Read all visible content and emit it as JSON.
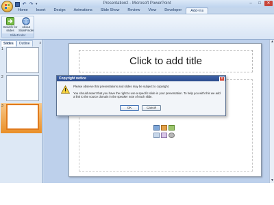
{
  "window": {
    "title": "Presentation2 - Microsoft PowerPoint",
    "controls": {
      "minimize": "–",
      "maximize": "□",
      "close": "✕"
    }
  },
  "qat": {
    "undo": "↶",
    "redo": "↷",
    "dropdown": "▾"
  },
  "ribbon": {
    "tabs": [
      "Home",
      "Insert",
      "Design",
      "Animations",
      "Slide Show",
      "Review",
      "View",
      "Developer",
      "Add-Ins"
    ],
    "active_tab": "Add-Ins",
    "group_label": "SlideFinder",
    "buttons": {
      "search": "Search for slides",
      "about": "About SlideFinder"
    }
  },
  "panel": {
    "tabs": [
      "Slides",
      "Outline"
    ],
    "close": "x",
    "thumbnails": [
      {
        "number": "1",
        "selected": false
      },
      {
        "number": "2",
        "selected": false
      },
      {
        "number": "3",
        "selected": true
      }
    ]
  },
  "slide": {
    "title_placeholder": "Click to add title"
  },
  "scrollbar": {
    "up": "▲",
    "down": "▼"
  },
  "dialog": {
    "title": "Copyright notice",
    "close": "x",
    "message_line1": "Please observe that presentations and slides may be subject to copyright.",
    "message_line2": "You should assert that you have the right to use a specific slide in your presentation. To help you with this we add a link to the source domain in the speaker note of each slide.",
    "ok_label": "OK",
    "cancel_label": "Cancel"
  },
  "colors": {
    "accent": "#2a4a8c",
    "selection": "#e98f28",
    "background": "#c4d6ec"
  }
}
